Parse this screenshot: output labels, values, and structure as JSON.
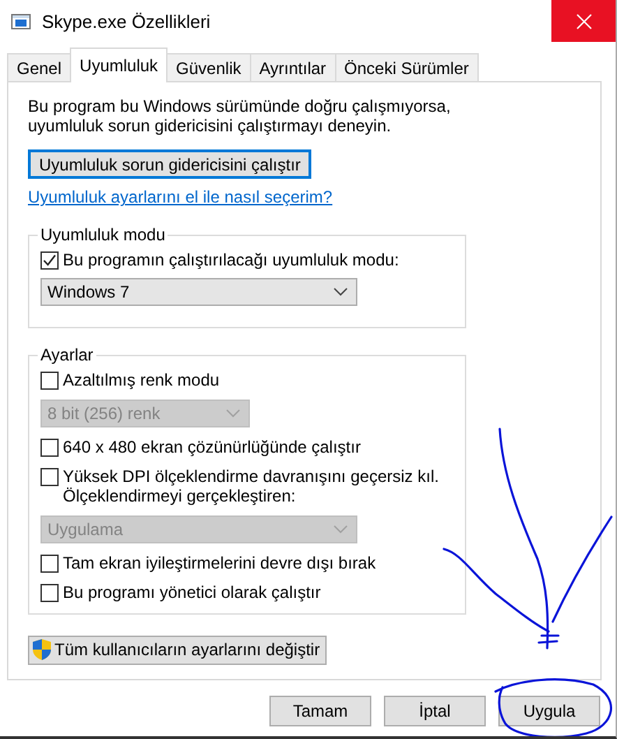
{
  "window": {
    "title": "Skype.exe Özellikleri"
  },
  "tabs": [
    {
      "label": "Genel",
      "selected": false
    },
    {
      "label": "Uyumluluk",
      "selected": true
    },
    {
      "label": "Güvenlik",
      "selected": false
    },
    {
      "label": "Ayrıntılar",
      "selected": false
    },
    {
      "label": "Önceki Sürümler",
      "selected": false
    }
  ],
  "intro": "Bu program bu Windows sürümünde doğru çalışmıyorsa, uyumluluk sorun gidericisini çalıştırmayı deneyin.",
  "troubleshooter_button": "Uyumluluk sorun gidericisini çalıştır",
  "help_link": "Uyumluluk ayarlarını el ile nasıl seçerim?",
  "compat_group": {
    "title": "Uyumluluk modu",
    "checkbox": {
      "label": "Bu programın çalıştırılacağı uyumluluk modu:",
      "checked": true
    },
    "dropdown": {
      "value": "Windows 7",
      "disabled": false
    }
  },
  "settings_group": {
    "title": "Ayarlar",
    "items": [
      {
        "kind": "checkbox",
        "label": "Azaltılmış renk modu",
        "checked": false
      },
      {
        "kind": "dropdown",
        "value": "8 bit (256) renk",
        "disabled": true
      },
      {
        "kind": "checkbox",
        "label": "640 x 480 ekran çözünürlüğünde çalıştır",
        "checked": false
      },
      {
        "kind": "checkbox",
        "label": "Yüksek DPI ölçeklendirme davranışını geçersiz kıl.\nÖlçeklendirmeyi gerçekleştiren:",
        "checked": false
      },
      {
        "kind": "dropdown",
        "value": "Uygulama",
        "disabled": true
      },
      {
        "kind": "checkbox",
        "label": "Tam ekran iyileştirmelerini devre dışı bırak",
        "checked": false
      },
      {
        "kind": "checkbox",
        "label": "Bu programı yönetici olarak çalıştır",
        "checked": false
      }
    ]
  },
  "all_users_button": "Tüm kullanıcıların ayarlarını değiştir",
  "buttons": [
    {
      "label": "Tamam"
    },
    {
      "label": "İptal"
    },
    {
      "label": "Uygula"
    }
  ]
}
